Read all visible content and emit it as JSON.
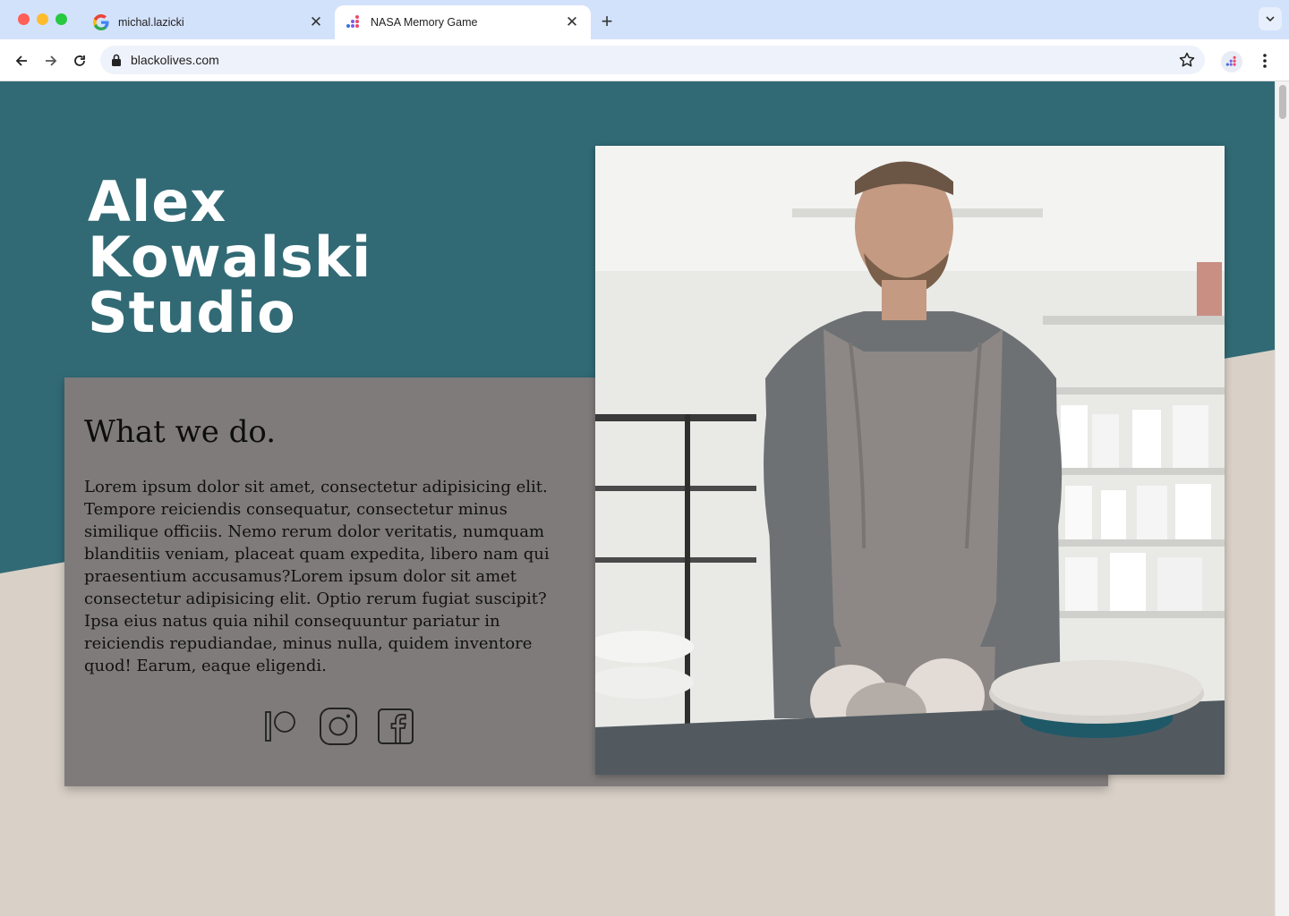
{
  "browser": {
    "tabs": [
      {
        "label": "michal.lazicki",
        "icon": "google-icon"
      },
      {
        "label": "NASA Memory Game",
        "icon": "dots-app-icon",
        "active": true
      }
    ],
    "url": "blackolives.com"
  },
  "page": {
    "site_title": "Alex\nKowalski\nStudio",
    "section_heading": "What we do.",
    "body_text": "Lorem ipsum dolor sit amet, consectetur adipisicing elit. Tempore reiciendis consequatur, consectetur minus similique officiis. Nemo rerum dolor veritatis, numquam blanditiis veniam, placeat quam expedita, libero nam qui praesentium accusamus?Lorem ipsum dolor sit amet consectetur adipisicing elit. Optio rerum fugiat suscipit? Ipsa eius natus quia nihil consequuntur pariatur in reiciendis repudiandae, minus nulla, quidem inventore quod! Earum, eaque eligendi.",
    "socials": [
      "patreon-icon",
      "instagram-icon",
      "facebook-icon"
    ],
    "photo": "potter-kneading-clay-photo"
  },
  "colors": {
    "teal": "#316a75",
    "beige": "#d9d1c7",
    "card": "#7f7b7b",
    "tabstrip": "#d3e2fb"
  }
}
